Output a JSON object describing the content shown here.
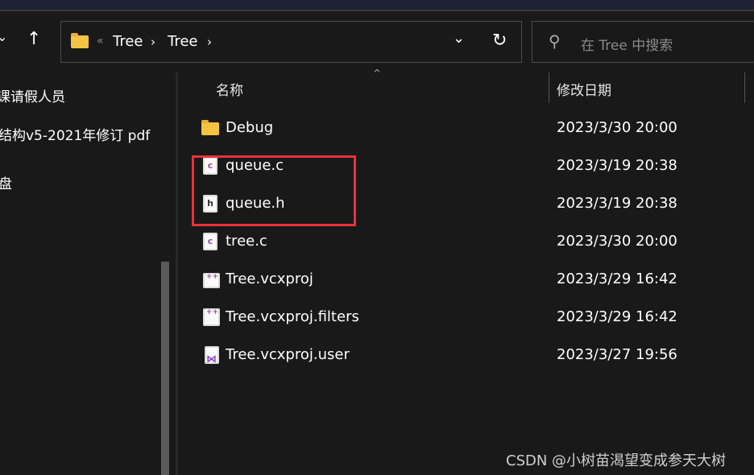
{
  "breadcrumb": {
    "overflow": "«",
    "items": [
      "Tree",
      "Tree"
    ]
  },
  "search": {
    "placeholder": "在 Tree 中搜索"
  },
  "sidebar": {
    "items": [
      "课请假人员",
      "结构v5-2021年修订 pdf",
      "盘"
    ]
  },
  "columns": {
    "name": "名称",
    "date": "修改日期"
  },
  "files": [
    {
      "name": "Debug",
      "date": "2023/3/30 20:00",
      "icon": "folder-icon"
    },
    {
      "name": "queue.c",
      "date": "2023/3/19 20:38",
      "icon": "c-file-icon"
    },
    {
      "name": "queue.h",
      "date": "2023/3/19 20:38",
      "icon": "h-file-icon"
    },
    {
      "name": "tree.c",
      "date": "2023/3/30 20:00",
      "icon": "c-file-icon"
    },
    {
      "name": "Tree.vcxproj",
      "date": "2023/3/29 16:42",
      "icon": "vcxproj-icon"
    },
    {
      "name": "Tree.vcxproj.filters",
      "date": "2023/3/29 16:42",
      "icon": "filters-icon"
    },
    {
      "name": "Tree.vcxproj.user",
      "date": "2023/3/27 19:56",
      "icon": "vs-user-icon"
    }
  ],
  "highlight_color": "#e8323a",
  "watermark": "CSDN @小树苗渴望变成参天大树"
}
